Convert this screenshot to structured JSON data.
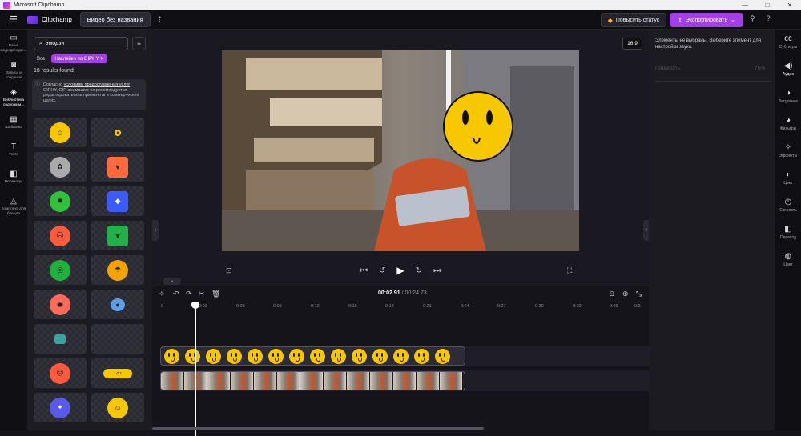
{
  "titlebar": {
    "title": "Microsoft Clipchamp",
    "minimize": "—",
    "maximize": "□",
    "close": "✕"
  },
  "appbar": {
    "menu_icon": "☰",
    "app_name": "Clipchamp",
    "project_name": "Видео без названия",
    "sync_icon": "⇡",
    "upgrade_label": "Повысить статус",
    "export_label": "Экспортировать",
    "export_chevron": "⌄",
    "share_icon": "⚲",
    "help_icon": "?"
  },
  "leftnav": [
    {
      "icon": "▭",
      "label": "Ваше медиаресурс..."
    },
    {
      "icon": "◙",
      "label": "Запись и создание"
    },
    {
      "icon": "◈",
      "label": "Библиотека содержим..."
    },
    {
      "icon": "▦",
      "label": "Шаблоны"
    },
    {
      "icon": "T",
      "label": "Текст"
    },
    {
      "icon": "◧",
      "label": "Переходы"
    },
    {
      "icon": "◬",
      "label": "Комплект для бренда"
    }
  ],
  "library": {
    "search_value": "эмодзи",
    "filter_icon": "≡",
    "chip_all": "Все",
    "chip_selected": "Наклейки по GIPHY",
    "chip_close": "✕",
    "results_text": "18 results found",
    "notice_icon": "ⓘ",
    "notice_prefix": "Согласно ",
    "notice_link": "условиям предоставления услуг",
    "notice_suffix": " GIPHY, GIF-анимацию не рекомендуется редактировать или применять в коммерческих целях."
  },
  "stickers": [
    {
      "glyph": "☺",
      "color": "#f7c700"
    },
    {
      "glyph": "•",
      "color": "#f7c700"
    },
    {
      "glyph": "✿",
      "color": "#aaaaaa"
    },
    {
      "glyph": "▼",
      "color": "#ff6a3d"
    },
    {
      "glyph": "✹",
      "color": "#32c13c"
    },
    {
      "glyph": "◆",
      "color": "#3b5bff"
    },
    {
      "glyph": "☹",
      "color": "#ff5a3d"
    },
    {
      "glyph": "▼",
      "color": "#22b04a"
    },
    {
      "glyph": "◎",
      "color": "#1fb23a"
    },
    {
      "glyph": "☂",
      "color": "#f4a300"
    },
    {
      "glyph": "◉",
      "color": "#ff6a5a"
    },
    {
      "glyph": "●",
      "color": "#5aa0e8"
    },
    {
      "glyph": "",
      "color": "transparent"
    },
    {
      "glyph": "",
      "color": "transparent"
    },
    {
      "glyph": "☹",
      "color": "#ff5a3d"
    },
    {
      "glyph": "〰",
      "color": "#f7c700"
    },
    {
      "glyph": "✦",
      "color": "#5a5ae8"
    },
    {
      "glyph": "☺",
      "color": "#f7c700"
    }
  ],
  "stage": {
    "aspect_ratio": "16:9",
    "collapse_left": "‹",
    "collapse_right": "›",
    "screenshot_icon": "⊡",
    "skip_back": "⏮",
    "rewind": "↺",
    "play": "▶",
    "forward": "↻",
    "skip_forward": "⏭",
    "fullscreen_icon": "⛶",
    "expand": "⌄"
  },
  "timeline": {
    "current_time": "00:02.91",
    "total_time": "/ 00:24.73",
    "magic_icon": "✧",
    "undo_icon": "↶",
    "redo_icon": "↷",
    "split_icon": "✂",
    "delete_icon": "🗑",
    "zoom_out_icon": "⊖",
    "zoom_in_icon": "⊕",
    "fit_icon": "⤡",
    "ruler": [
      "0",
      "0:03",
      "0:06",
      "0:09",
      "0:12",
      "0:15",
      "0:18",
      "0:21",
      "0:24",
      "0:27",
      "0:30",
      "0:33",
      "0:36",
      "0:3"
    ]
  },
  "props": {
    "message": "Элементы не выбраны. Выберите элемент для настройки звука.",
    "volume_label": "Громкость",
    "volume_value": "75%"
  },
  "rightnav": [
    {
      "icon": "㏄",
      "label": "Субтитры"
    },
    {
      "icon": "◀)",
      "label": "Аудио"
    },
    {
      "icon": "◑",
      "label": "Затухание"
    },
    {
      "icon": "◕",
      "label": "Фильтры"
    },
    {
      "icon": "✧",
      "label": "Эффекты"
    },
    {
      "icon": "◐",
      "label": "Цвет"
    },
    {
      "icon": "◷",
      "label": "Скорость"
    },
    {
      "icon": "◧",
      "label": "Переход"
    },
    {
      "icon": "◍",
      "label": "Цвет"
    }
  ]
}
